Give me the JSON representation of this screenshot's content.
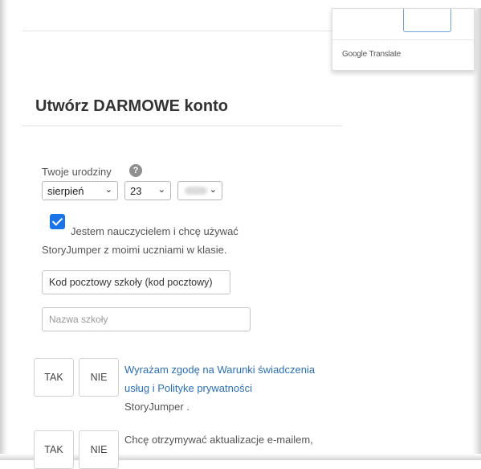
{
  "translate_popup": {
    "label": "Google Translate"
  },
  "form": {
    "title": "Utwórz DARMOWE konto",
    "birthday": {
      "label": "Twoje urodziny",
      "help_icon": "question-circle-icon",
      "month": "sierpień",
      "day": "23",
      "year": ""
    },
    "teacher": {
      "checked": true,
      "line1": "Jestem nauczycielem i chcę używać",
      "line2": "StoryJumper z moimi uczniami w klasie."
    },
    "zip_field": {
      "value": "Kod pocztowy szkoły (kod pocztowy)"
    },
    "school_field": {
      "placeholder": "Nazwa szkoły"
    },
    "consent_terms": {
      "yes_label": "TAK",
      "no_label": "NIE",
      "link_line1": "Wyrażam zgodę na Warunki świadczenia",
      "link_line2": "usług i Polityke prywatności",
      "suffix": "StoryJumper ."
    },
    "consent_email": {
      "yes_label": "TAK",
      "no_label": "NIE",
      "text": "Chcę otrzymywać aktualizacje e-mailem,"
    }
  },
  "colors": {
    "checkbox": "#1a73e8",
    "link": "#2a6fb6"
  }
}
